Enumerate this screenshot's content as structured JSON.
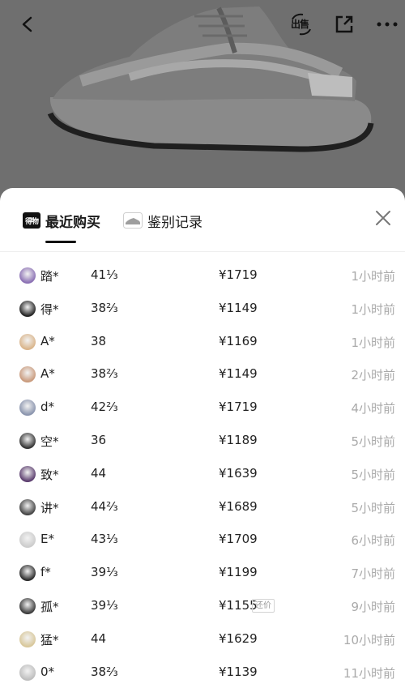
{
  "top_bar": {
    "back_icon": "chevron-left-icon",
    "sell_label": "出售",
    "share_icon": "share-external-icon",
    "more_icon": "more-horizontal-icon"
  },
  "product_image": "sneaker-image",
  "sheet": {
    "tabs": [
      {
        "badge": "得物",
        "label": "最近购买",
        "active": true
      },
      {
        "label": "鉴别记录",
        "active": false
      }
    ],
    "close_icon": "close-icon",
    "purchases": [
      {
        "name": "踏*",
        "size": "41⅓",
        "price": "¥1719",
        "tag": "",
        "time": "1小时前",
        "avatar_color": "#8a6fb3"
      },
      {
        "name": "得*",
        "size": "38⅔",
        "price": "¥1149",
        "tag": "",
        "time": "1小时前",
        "avatar_color": "#222222"
      },
      {
        "name": "A*",
        "size": "38",
        "price": "¥1169",
        "tag": "",
        "time": "1小时前",
        "avatar_color": "#d9b48a"
      },
      {
        "name": "A*",
        "size": "38⅔",
        "price": "¥1149",
        "tag": "",
        "time": "2小时前",
        "avatar_color": "#c99a7c"
      },
      {
        "name": "d*",
        "size": "42⅔",
        "price": "¥1719",
        "tag": "",
        "time": "4小时前",
        "avatar_color": "#8a94ad"
      },
      {
        "name": "空*",
        "size": "36",
        "price": "¥1189",
        "tag": "",
        "time": "5小时前",
        "avatar_color": "#333333"
      },
      {
        "name": "致*",
        "size": "44",
        "price": "¥1639",
        "tag": "",
        "time": "5小时前",
        "avatar_color": "#5b3d6e"
      },
      {
        "name": "讲*",
        "size": "44⅔",
        "price": "¥1689",
        "tag": "",
        "time": "5小时前",
        "avatar_color": "#444444"
      },
      {
        "name": "E*",
        "size": "43⅓",
        "price": "¥1709",
        "tag": "",
        "time": "6小时前",
        "avatar_color": "#cccccc"
      },
      {
        "name": "f*",
        "size": "39⅓",
        "price": "¥1199",
        "tag": "",
        "time": "7小时前",
        "avatar_color": "#2a2a2a"
      },
      {
        "name": "孤*",
        "size": "39⅓",
        "price": "¥1155",
        "tag": "还价",
        "time": "9小时前",
        "avatar_color": "#3a3a3a"
      },
      {
        "name": "猛*",
        "size": "44",
        "price": "¥1629",
        "tag": "",
        "time": "10小时前",
        "avatar_color": "#d8c79a"
      },
      {
        "name": "0*",
        "size": "38⅔",
        "price": "¥1139",
        "tag": "",
        "time": "11小时前",
        "avatar_color": "#bdbdbd"
      }
    ]
  }
}
